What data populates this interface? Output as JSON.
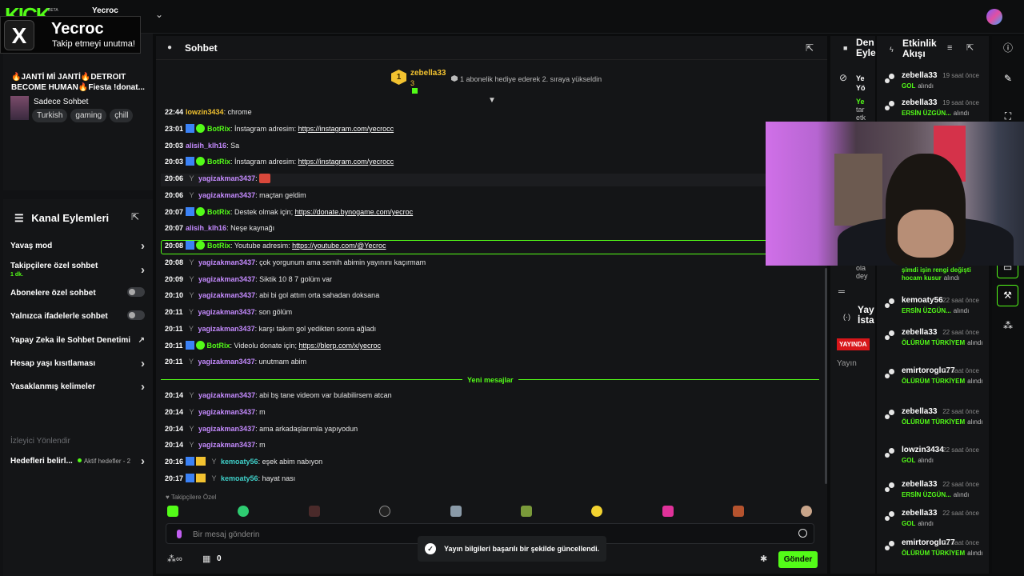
{
  "topbar": {
    "logo": "KICK",
    "beta": "BETA",
    "user": "Yecroc"
  },
  "xcard": {
    "icon": "X",
    "name": "Yecroc",
    "sub": "Takip etmeyi unutma!"
  },
  "stream": {
    "title": "🔥JANTİ Mİ JANTİ🔥DETROIT BECOME HUMAN🔥Fiesta !donat...",
    "category": "Sadece Sohbet",
    "tags": [
      "Turkish",
      "gaming",
      "çhill"
    ]
  },
  "channel_actions": {
    "title": "Kanal Eylemleri",
    "items": [
      {
        "label": "Yavaş mod"
      },
      {
        "label": "Takipçilere özel sohbet",
        "sub": "1 dk."
      },
      {
        "label": "Abonelere özel sohbet"
      },
      {
        "label": "Yalnızca ifadelerle sohbet"
      },
      {
        "label": "Yapay Zeka ile Sohbet Denetimi"
      },
      {
        "label": "Hesap yaşı kısıtlaması"
      },
      {
        "label": "Yasaklanmış kelimeler"
      }
    ],
    "section": "İzleyici Yönlendir",
    "goals_label": "Hedefleri belirl...",
    "goals_status": "Aktif hedefler - 2"
  },
  "chat": {
    "title": "Sohbet",
    "pinned": {
      "rank": "1",
      "user": "zebella33",
      "count": "3",
      "text": "1 abonelik hediye ederek 2. sıraya yükseldin"
    },
    "messages": [
      {
        "time": "22:44",
        "user": "lowzin3434",
        "color": "#f2c230",
        "text": "chrome",
        "badges": ""
      },
      {
        "time": "23:01",
        "user": "BotRix",
        "color": "#53fc18",
        "text": "İnstagram adresim: ",
        "link": "https://instagram.com/yecrocc",
        "badges": "bot"
      },
      {
        "time": "20:03",
        "user": "alisih_klh16",
        "color": "#c58bff",
        "text": "Sa",
        "badges": ""
      },
      {
        "time": "20:03",
        "user": "BotRix",
        "color": "#53fc18",
        "text": "İnstagram adresim: ",
        "link": "https://instagram.com/yecrocc",
        "badges": "bot"
      },
      {
        "time": "20:06",
        "user": "yagizakman3437",
        "color": "#c58bff",
        "text": "",
        "badges": "fork",
        "emote": true
      },
      {
        "time": "20:06",
        "user": "yagizakman3437",
        "color": "#c58bff",
        "text": "maçtan geldim",
        "badges": "fork"
      },
      {
        "time": "20:07",
        "user": "BotRix",
        "color": "#53fc18",
        "text": "Destek olmak için; ",
        "link": "https://donate.bynogame.com/yecroc",
        "badges": "bot"
      },
      {
        "time": "20:07",
        "user": "alisih_klh16",
        "color": "#c58bff",
        "text": "Neşe kaynağı",
        "badges": ""
      },
      {
        "time": "20:08",
        "user": "BotRix",
        "color": "#53fc18",
        "text": "Youtube adresim: ",
        "link": "https://youtube.com/@Yecroc",
        "badges": "bot"
      },
      {
        "time": "20:08",
        "user": "yagizakman3437",
        "color": "#c58bff",
        "text": "çok yorgunum ama semih abimin yayınını kaçırmam",
        "badges": "fork"
      },
      {
        "time": "20:09",
        "user": "yagizakman3437",
        "color": "#c58bff",
        "text": "Siktik 10 8 7 golüm var",
        "badges": "fork"
      },
      {
        "time": "20:10",
        "user": "yagizakman3437",
        "color": "#c58bff",
        "text": "abi bi gol attım orta sahadan doksana",
        "badges": "fork"
      },
      {
        "time": "20:11",
        "user": "yagizakman3437",
        "color": "#c58bff",
        "text": "son gölüm",
        "badges": "fork"
      },
      {
        "time": "20:11",
        "user": "yagizakman3437",
        "color": "#c58bff",
        "text": "karşı takım gol yedikten sonra ağladı",
        "badges": "fork"
      },
      {
        "time": "20:11",
        "user": "BotRix",
        "color": "#53fc18",
        "text": "Videolu donate için; ",
        "link": "https://blerp.com/x/yecroc",
        "badges": "bot"
      },
      {
        "time": "20:11",
        "user": "yagizakman3437",
        "color": "#c58bff",
        "text": "unutmam abim",
        "badges": "fork"
      },
      {
        "time": "20:14",
        "user": "yagizakman3437",
        "color": "#c58bff",
        "text": "abi bş tane videom var bulabilirsem atcan",
        "badges": "fork"
      },
      {
        "time": "20:14",
        "user": "yagizakman3437",
        "color": "#c58bff",
        "text": "m",
        "badges": "fork"
      },
      {
        "time": "20:14",
        "user": "yagizakman3437",
        "color": "#c58bff",
        "text": "ama arkadaşlarımla yapıyodun",
        "badges": "fork"
      },
      {
        "time": "20:14",
        "user": "yagizakman3437",
        "color": "#c58bff",
        "text": "m",
        "badges": "fork"
      },
      {
        "time": "20:16",
        "user": "kemoaty56",
        "color": "#3fd0c9",
        "text": "eşek abim nabıyon",
        "badges": "sub"
      },
      {
        "time": "20:17",
        "user": "kemoaty56",
        "color": "#3fd0c9",
        "text": "hayat nası",
        "badges": "sub"
      }
    ],
    "new_messages": "Yeni mesajlar",
    "followers_only": "Takipçilere Özel",
    "input_placeholder": "Bir mesaj gönderin",
    "gift_count": "0",
    "send": "Gönder"
  },
  "toast": "Yayın bilgileri başarılı bir şekilde güncellendi.",
  "mid": {
    "head": "Den Eyle",
    "lines": [
      "Ye",
      "Yö"
    ],
    "green_line": "Ye",
    "grey": [
      "tar",
      "etk"
    ],
    "grey2": [
      "ola",
      "dey"
    ],
    "head2": "Yay İsta",
    "live": "YAYINDA",
    "yayin": "Yayın"
  },
  "activity": {
    "title": "Etkinlik Akışı",
    "events": [
      {
        "user": "zebella33",
        "time": "19 saat önce",
        "reward": "GOL",
        "desc": "alındı"
      },
      {
        "user": "zebella33",
        "time": "19 saat önce",
        "reward": "ERSİN ÜZGÜN...",
        "desc": "alındı"
      },
      {
        "user": "",
        "time": "",
        "reward": "şimdi işin rengi değişti hocam kusur",
        "desc": "alındı"
      },
      {
        "user": "kemoaty56",
        "time": "22 saat önce",
        "reward": "ERSİN ÜZGÜN...",
        "desc": "alındı"
      },
      {
        "user": "zebella33",
        "time": "22 saat önce",
        "reward": "ÖLÜRÜM TÜRKİYEM",
        "desc": "alındı"
      },
      {
        "user": "emirtoroglu77",
        "time": "22 saat önce",
        "reward": "ÖLÜRÜM TÜRKİYEM",
        "desc": "alındı"
      },
      {
        "user": "zebella33",
        "time": "22 saat önce",
        "reward": "ÖLÜRÜM TÜRKİYEM",
        "desc": "alındı"
      },
      {
        "user": "lowzin3434",
        "time": "22 saat önce",
        "reward": "GOL",
        "desc": "alındı"
      },
      {
        "user": "zebella33",
        "time": "22 saat önce",
        "reward": "ERSİN ÜZGÜN...",
        "desc": "alındı"
      },
      {
        "user": "zebella33",
        "time": "22 saat önce",
        "reward": "GOL",
        "desc": "alındı"
      },
      {
        "user": "emirtoroglu77",
        "time": "22 saat önce",
        "reward": "ÖLÜRÜM TÜRKİYEM",
        "desc": "alındı"
      }
    ]
  },
  "colors": {
    "accent": "#53fc18",
    "bg": "#0b0c0d",
    "panel": "#141517",
    "bot": "#3b82f6",
    "gold": "#f2c230",
    "live": "#d8161a"
  }
}
